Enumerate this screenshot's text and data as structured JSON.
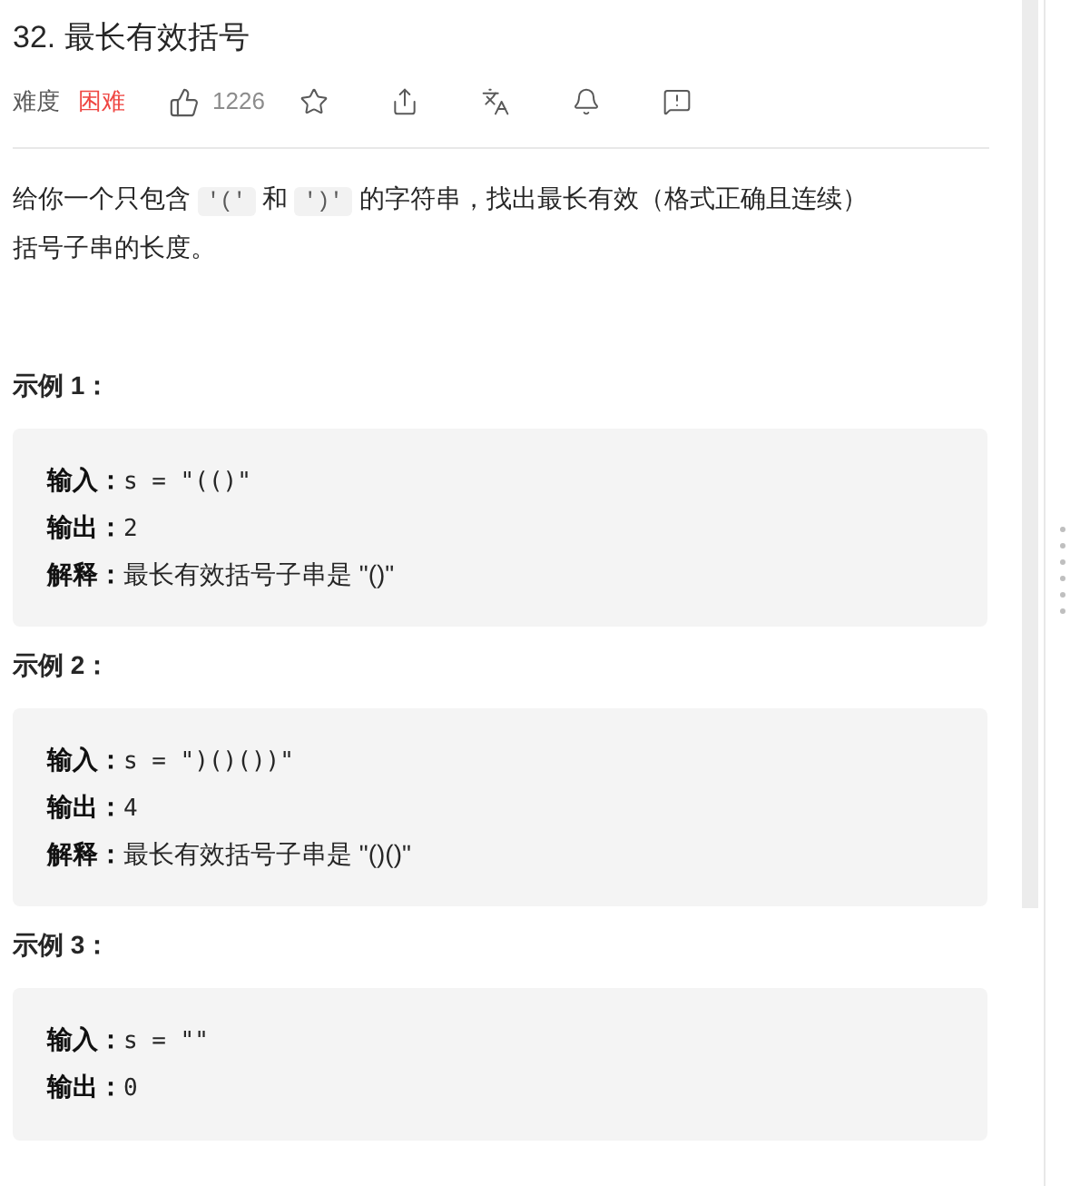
{
  "title": "32. 最长有效括号",
  "meta": {
    "difficulty_label": "难度",
    "difficulty": "困难",
    "likes": "1226"
  },
  "description": [
    {
      "kind": "text",
      "text": "给你一个只包含 "
    },
    {
      "kind": "code",
      "text": "'('"
    },
    {
      "kind": "text",
      "text": " 和 "
    },
    {
      "kind": "code",
      "text": "')'"
    },
    {
      "kind": "text",
      "text": " 的字符串，找出最长有效（格式正确且连续）括号子串的长度。"
    }
  ],
  "examples": [
    {
      "heading": "示例 1：",
      "lines": [
        {
          "label": "输入：",
          "kind": "mono",
          "value": "s = \"(()\""
        },
        {
          "label": "输出：",
          "kind": "mono",
          "value": "2"
        },
        {
          "label": "解释：",
          "kind": "text",
          "value": "最长有效括号子串是 \"()\""
        }
      ]
    },
    {
      "heading": "示例 2：",
      "lines": [
        {
          "label": "输入：",
          "kind": "mono",
          "value": "s = \")()())\""
        },
        {
          "label": "输出：",
          "kind": "mono",
          "value": "4"
        },
        {
          "label": "解释：",
          "kind": "text",
          "value": "最长有效括号子串是 \"()()\""
        }
      ]
    },
    {
      "heading": "示例 3：",
      "lines": [
        {
          "label": "输入：",
          "kind": "mono",
          "value": "s = \"\""
        },
        {
          "label": "输出：",
          "kind": "mono",
          "value": "0"
        }
      ]
    }
  ]
}
